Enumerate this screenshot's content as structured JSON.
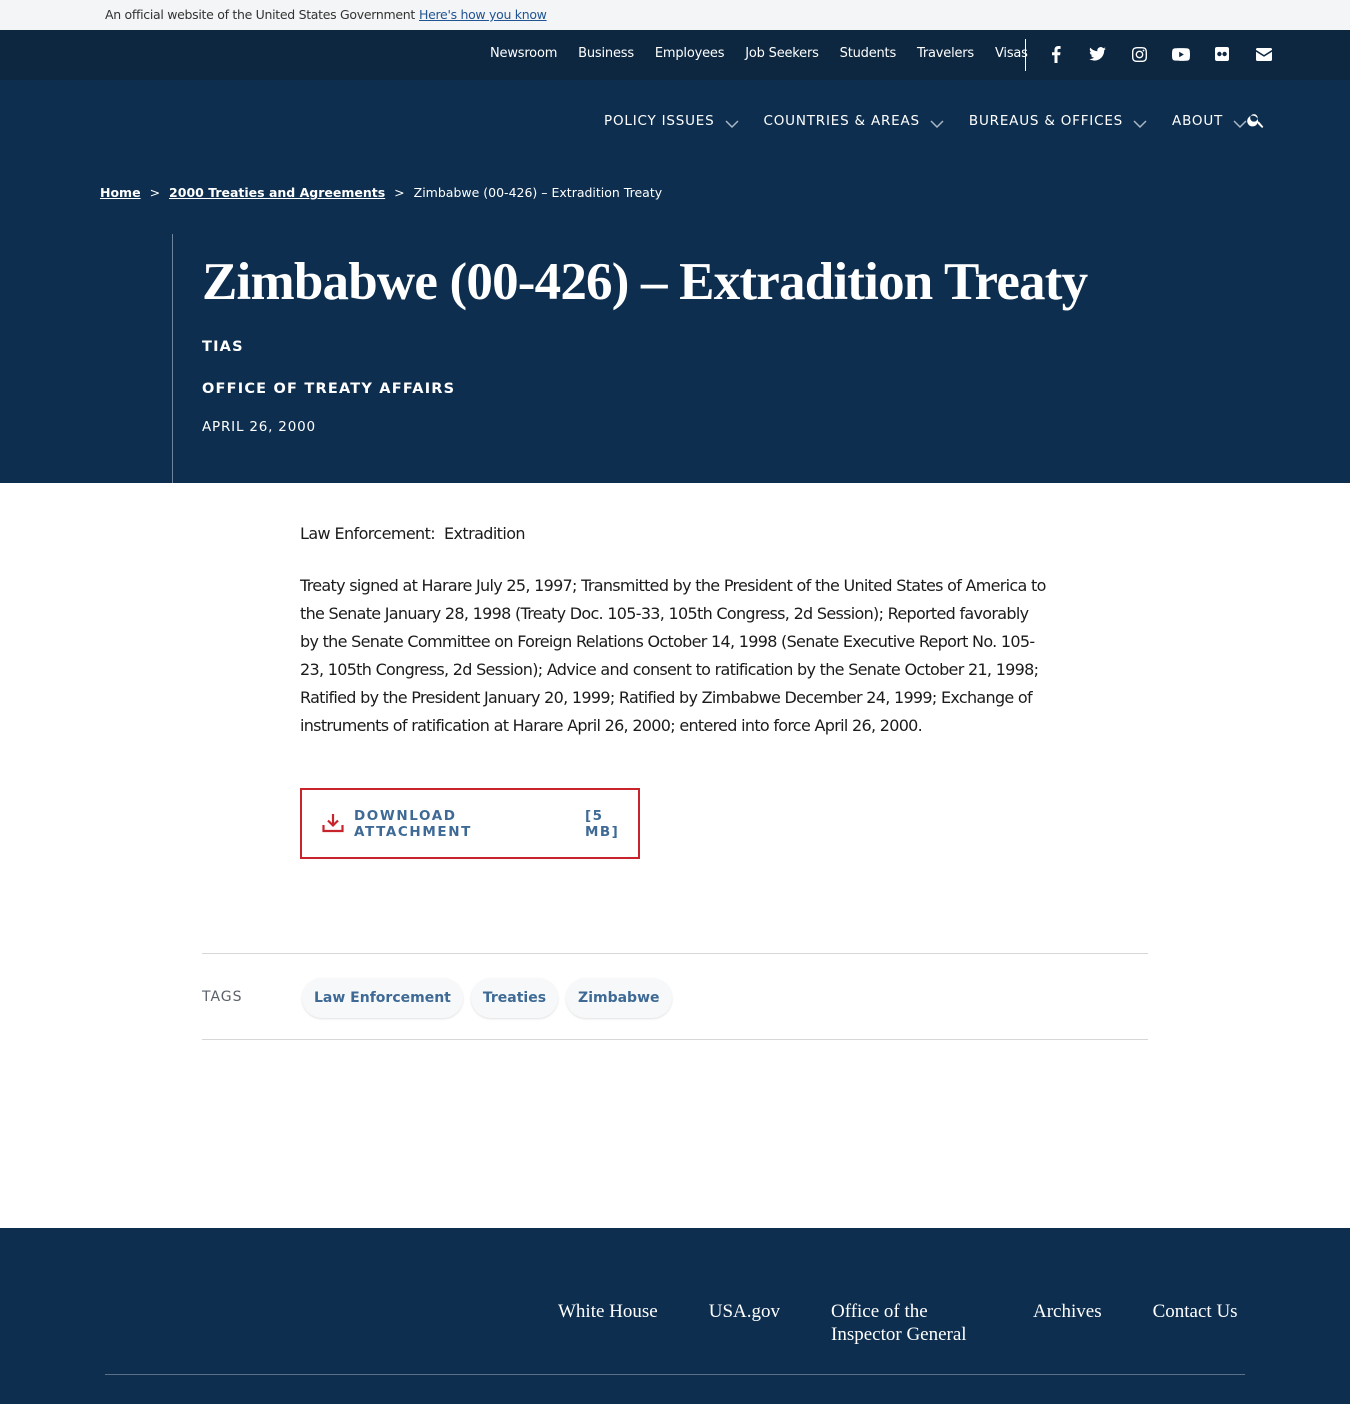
{
  "gov_banner": {
    "text": "An official website of the United States Government",
    "link": "Here's how you know"
  },
  "utility_nav": {
    "links": [
      "Newsroom",
      "Business",
      "Employees",
      "Job Seekers",
      "Students",
      "Travelers",
      "Visas"
    ],
    "social_icons": [
      "facebook-icon",
      "twitter-icon",
      "instagram-icon",
      "youtube-icon",
      "flickr-icon",
      "email-icon"
    ]
  },
  "main_nav": {
    "items": [
      "POLICY ISSUES",
      "COUNTRIES & AREAS",
      "BUREAUS & OFFICES",
      "ABOUT"
    ],
    "search_icon": "search-icon"
  },
  "breadcrumb": {
    "home": "Home",
    "parent": "2000 Treaties and Agreements",
    "current": "Zimbabwe (00-426) – Extradition Treaty",
    "separator": ">"
  },
  "hero": {
    "title": "Zimbabwe (00-426) – Extradition Treaty",
    "series": "TIAS",
    "office": "OFFICE OF TREATY AFFAIRS",
    "date": "APRIL 26, 2000"
  },
  "content": {
    "subject": "Law Enforcement:  Extradition",
    "paragraph": "Treaty signed at Harare July 25, 1997; Transmitted by the President of the United States of America to the Senate January 28, 1998 (Treaty Doc. 105-33, 105th Congress, 2d Session); Reported favorably by the Senate Committee on Foreign Relations October 14, 1998 (Senate Executive Report No. 105-23, 105th Congress, 2d Session); Advice and consent to ratification by the Senate October 21, 1998; Ratified by the President January 20, 1999; Ratified by Zimbabwe December 24, 1999; Exchange of instruments of ratification at Harare April 26, 2000; entered into force April 26, 2000."
  },
  "download": {
    "label": "DOWNLOAD ATTACHMENT",
    "size": "[5 MB]",
    "icon": "download-icon"
  },
  "tags": {
    "label": "TAGS",
    "items": [
      "Law Enforcement",
      "Treaties",
      "Zimbabwe"
    ]
  },
  "footer": {
    "links": [
      "White House",
      "USA.gov",
      "Office of the Inspector General",
      "Archives",
      "Contact Us"
    ]
  },
  "colors": {
    "navy_dark": "#0d2740",
    "navy": "#0d2e4e",
    "link_blue": "#3e6a95",
    "download_border": "#c8242c"
  }
}
